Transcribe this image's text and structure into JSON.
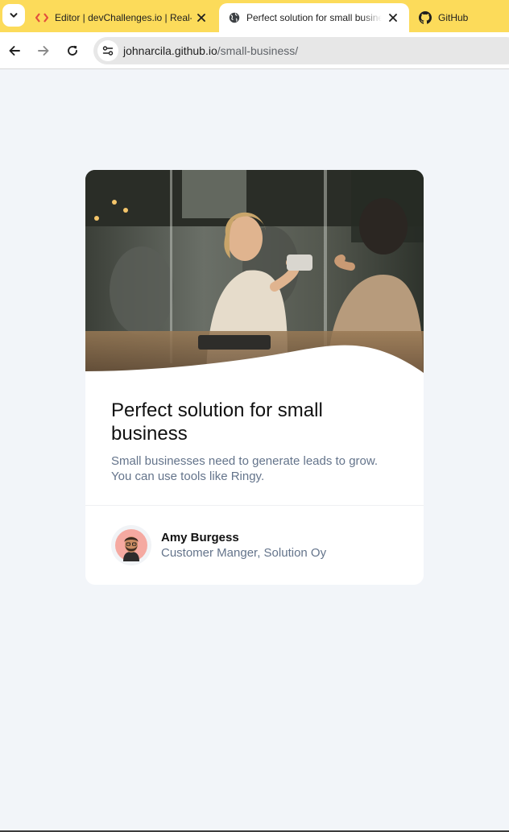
{
  "browser": {
    "tabs": [
      {
        "title": "Editor | devChallenges.io | Real-",
        "icon": "devchallenges-icon",
        "active": false
      },
      {
        "title": "Perfect solution for small business",
        "icon": "globe-icon",
        "active": true
      },
      {
        "title": "GitHub",
        "icon": "github-icon",
        "active": false
      }
    ],
    "address": {
      "host": "johnarcila.github.io",
      "path": "/small-business/"
    },
    "colors": {
      "tabbar": "#fcdb5a",
      "active_tab": "#ffffff"
    }
  },
  "card": {
    "title": "Perfect solution for small business",
    "description": "Small businesses need to generate leads to grow. You can use tools like Ringy.",
    "author": {
      "name": "Amy Burgess",
      "role": "Customer Manger, Solution Oy"
    }
  }
}
